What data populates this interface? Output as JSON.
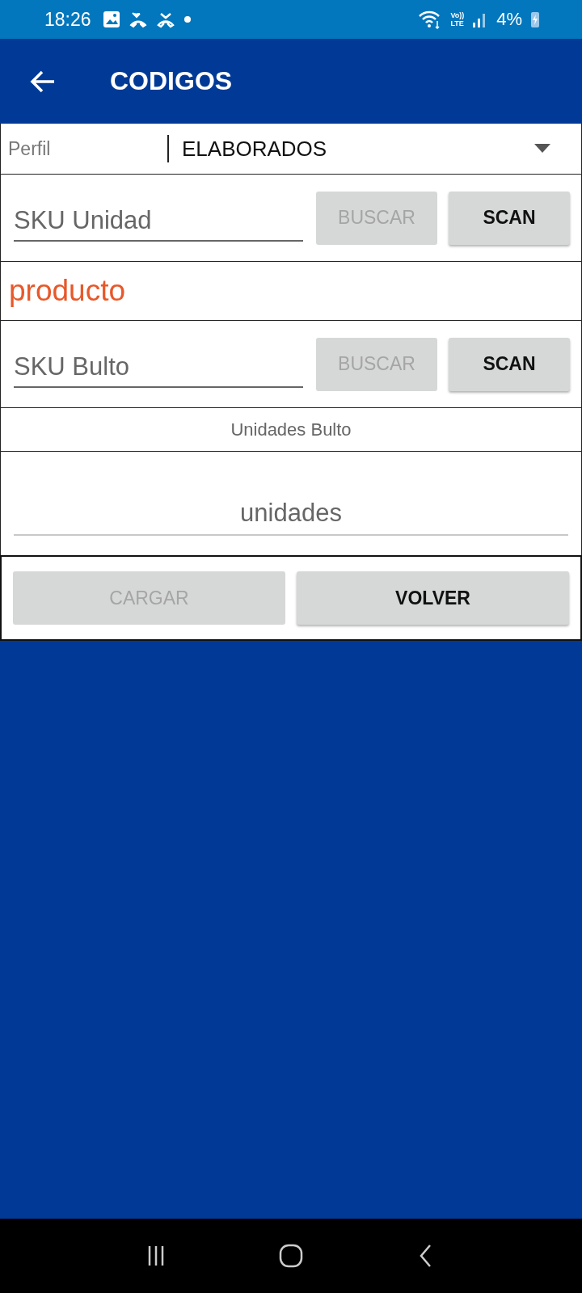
{
  "status_bar": {
    "time": "18:26",
    "network": [
      "Vo))",
      "LTE"
    ],
    "battery": "4%"
  },
  "app_bar": {
    "title": "CODIGOS"
  },
  "profile": {
    "label": "Perfil",
    "value": "ELABORADOS"
  },
  "sku_unit": {
    "placeholder": "SKU Unidad",
    "buttons": [
      {
        "label": "BUSCAR",
        "disabled": true
      },
      {
        "label": "SCAN",
        "disabled": false
      }
    ]
  },
  "product": "producto",
  "sku_package": {
    "placeholder": "SKU Bulto",
    "buttons": [
      {
        "label": "BUSCAR",
        "disabled": true
      },
      {
        "label": "SCAN",
        "disabled": false
      }
    ]
  },
  "units_label": "Unidades Bulto",
  "units": {
    "placeholder": "unidades"
  },
  "actions": [
    {
      "label": "CARGAR",
      "disabled": true
    },
    {
      "label": "VOLVER",
      "disabled": false
    }
  ]
}
